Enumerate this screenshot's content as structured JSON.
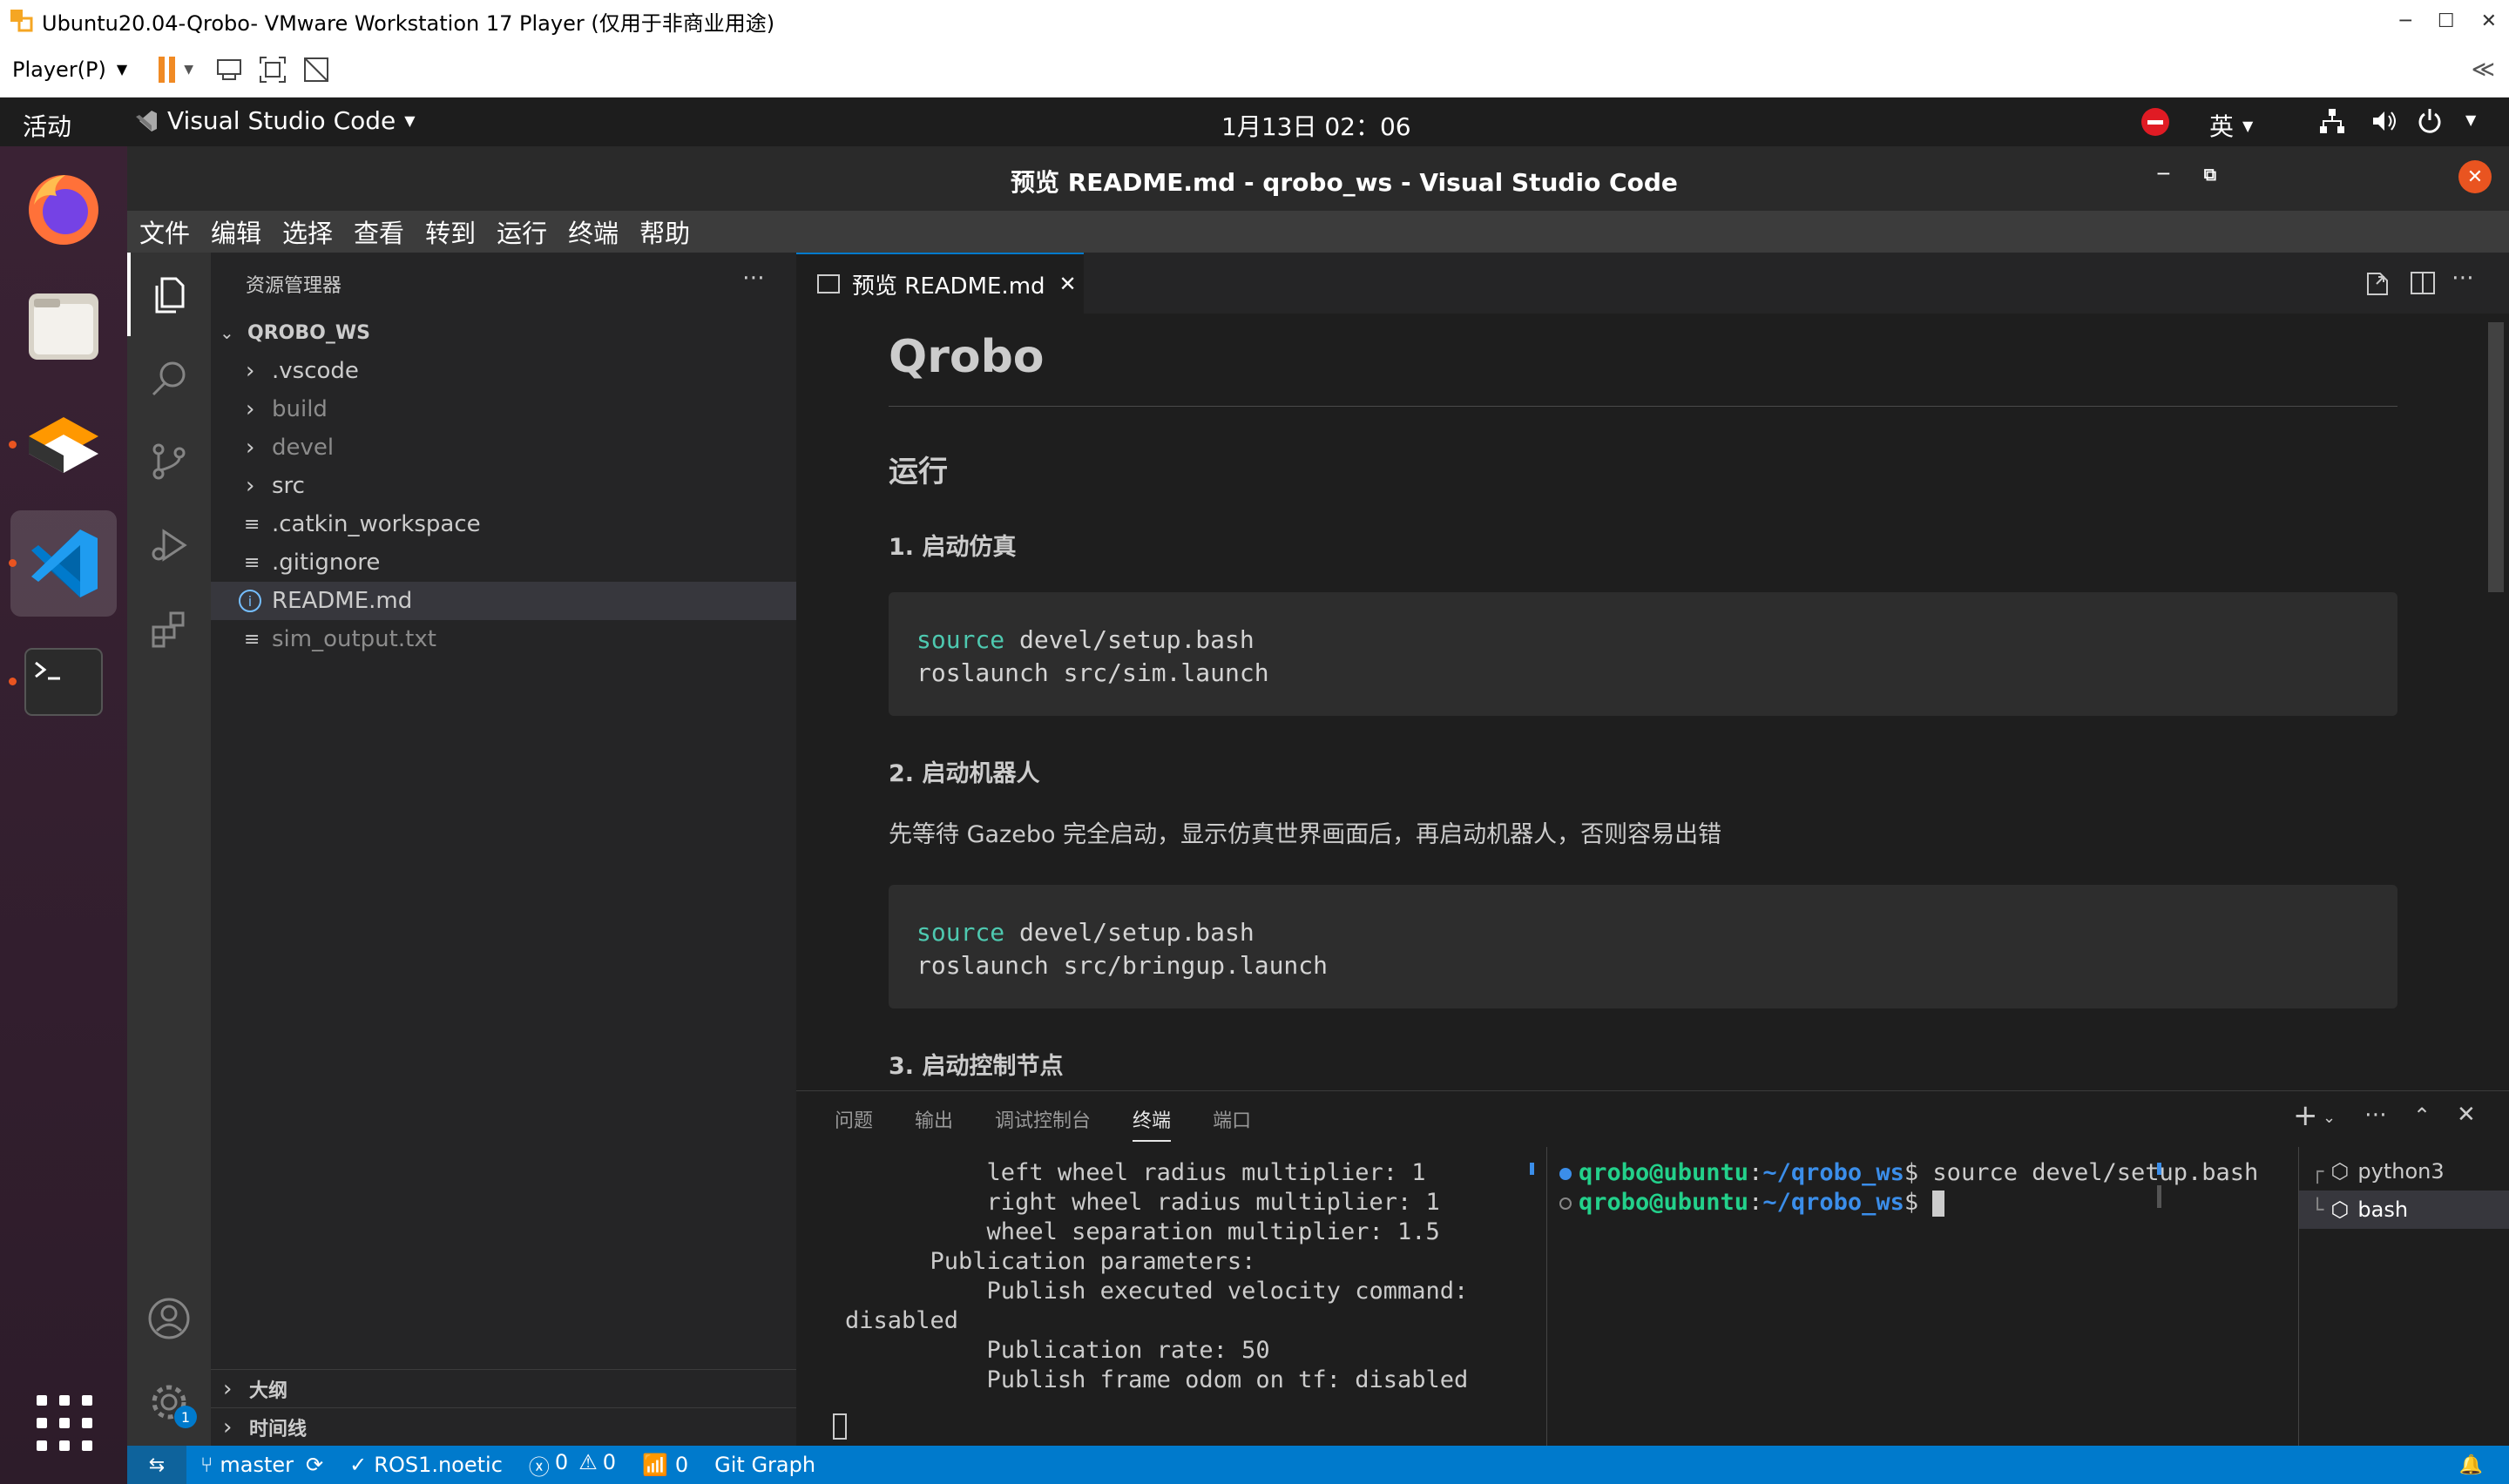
{
  "vmware": {
    "title": "Ubuntu20.04-Qrobo- VMware Workstation 17 Player (仅用于非商业用途)",
    "player_menu": "Player(P)"
  },
  "gnome": {
    "activities": "活动",
    "app_name": "Visual Studio Code",
    "clock": "1月13日  02：06",
    "input_method": "英"
  },
  "vscode": {
    "window_title": "预览 README.md - qrobo_ws - Visual Studio Code",
    "menu": [
      "文件",
      "编辑",
      "选择",
      "查看",
      "转到",
      "运行",
      "终端",
      "帮助"
    ],
    "explorer": {
      "title": "资源管理器",
      "root": "QROBO_WS",
      "items": [
        {
          "label": ".vscode",
          "type": "folder"
        },
        {
          "label": "build",
          "type": "folder"
        },
        {
          "label": "devel",
          "type": "folder"
        },
        {
          "label": "src",
          "type": "folder"
        },
        {
          "label": ".catkin_workspace",
          "type": "file"
        },
        {
          "label": ".gitignore",
          "type": "file"
        },
        {
          "label": "README.md",
          "type": "info"
        },
        {
          "label": "sim_output.txt",
          "type": "file"
        }
      ],
      "outline": "大纲",
      "timeline": "时间线"
    },
    "tab": {
      "label": "预览 README.md"
    },
    "preview": {
      "h1": "Qrobo",
      "h2": "运行",
      "step1": "1. 启动仿真",
      "code1_kw": "source",
      "code1_l1": " devel/setup.bash",
      "code1_l2": "roslaunch src/sim.launch",
      "step2": "2. 启动机器人",
      "note": "先等待 Gazebo 完全启动，显示仿真世界画面后，再启动机器人，否则容易出错",
      "code2_kw": "source",
      "code2_l1": " devel/setup.bash",
      "code2_l2": "roslaunch src/bringup.launch",
      "step3": "3. 启动控制节点"
    },
    "panel": {
      "tabs": [
        "问题",
        "输出",
        "调试控制台",
        "终端",
        "端口"
      ],
      "active_tab": "终端",
      "left_terminal": [
        "          left wheel radius multiplier: 1",
        "          right wheel radius multiplier: 1",
        "          wheel separation multiplier: 1.5",
        "      Publication parameters:",
        "          Publish executed velocity command:",
        "disabled",
        "          Publication rate: 50",
        "          Publish frame odom on tf: disabled"
      ],
      "prompt_user": "qrobo@ubuntu",
      "prompt_path": "~/qrobo_ws",
      "prompt_sym": "$",
      "cmd1": " source devel/setup.bash",
      "sessions": [
        "python3",
        "bash"
      ]
    },
    "status": {
      "branch": "master",
      "ros": "ROS1.noetic",
      "errors": "0",
      "warnings": "0",
      "ports": "0",
      "git_graph": "Git Graph",
      "settings_badge": "1"
    }
  },
  "colors": {
    "accent": "#007acc",
    "ubuntu_orange": "#e95420"
  }
}
